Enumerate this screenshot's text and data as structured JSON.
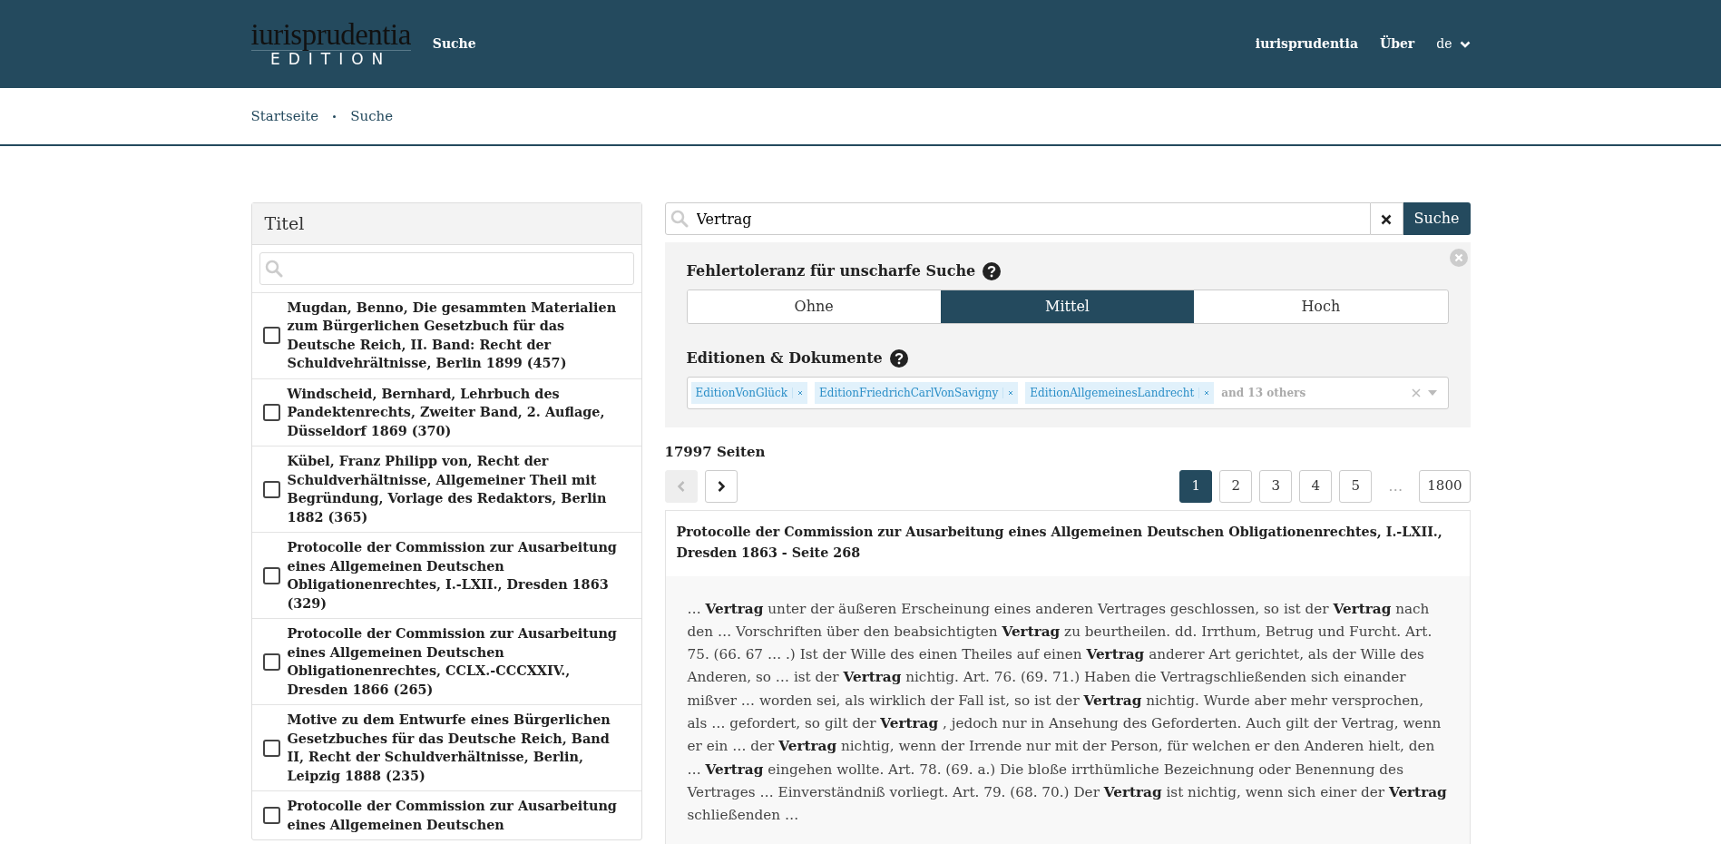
{
  "header": {
    "logo": {
      "title": "iurisprudentia",
      "subtitle": "EDITION"
    },
    "nav": [
      {
        "label": "Suche"
      }
    ],
    "right_nav": [
      {
        "label": "iurisprudentia"
      },
      {
        "label": "Über"
      }
    ],
    "language": {
      "label": "de"
    }
  },
  "breadcrumb": [
    {
      "label": "Startseite"
    },
    {
      "label": "Suche"
    }
  ],
  "title_filter": {
    "heading": "Titel",
    "items": [
      {
        "label": "Mugdan, Benno, Die gesammten Materialien zum Bürgerlichen Gesetzbuch für das Deutsche Reich, II. Band: Recht der Schuldvehrältnisse, Berlin 1899 (457)",
        "checked": false
      },
      {
        "label": "Windscheid, Bernhard, Lehrbuch des Pandektenrechts, Zweiter Band, 2. Auflage, Düsseldorf 1869 (370)",
        "checked": false
      },
      {
        "label": "Kübel, Franz Philipp von, Recht der Schuldverhältnisse, Allgemeiner Theil mit Begründung, Vorlage des Redaktors, Berlin 1882 (365)",
        "checked": false
      },
      {
        "label": "Protocolle der Commission zur Ausarbeitung eines Allgemeinen Deutschen Obligationenrechtes, I.-LXII., Dresden 1863 (329)",
        "checked": false
      },
      {
        "label": "Protocolle der Commission zur Ausarbeitung eines Allgemeinen Deutschen Obligationenrechtes, CCLX.-CCCXXIV., Dresden 1866 (265)",
        "checked": false
      },
      {
        "label": "Motive zu dem Entwurfe eines Bürgerlichen Gesetzbuches für das Deutsche Reich, Band II, Recht der Schuldverhältnisse, Berlin, Leipzig 1888 (235)",
        "checked": false
      },
      {
        "label": "Protocolle der Commission zur Ausarbeitung eines Allgemeinen Deutschen",
        "checked": false
      }
    ]
  },
  "search": {
    "value": "Vertrag",
    "button": "Suche"
  },
  "options": {
    "tolerance": {
      "label": "Fehlertoleranz für unscharfe Suche",
      "choices": [
        {
          "label": "Ohne",
          "selected": false
        },
        {
          "label": "Mittel",
          "selected": true
        },
        {
          "label": "Hoch",
          "selected": false
        }
      ]
    },
    "editions": {
      "label": "Editionen & Dokumente",
      "tags": [
        {
          "label": "EditionVonGlück"
        },
        {
          "label": "EditionFriedrichCarlVonSavigny"
        },
        {
          "label": "EditionAllgemeinesLandrecht"
        }
      ],
      "more": "and 13 others"
    }
  },
  "results": {
    "count": "17997 Seiten",
    "prev_disabled": true,
    "pages": [
      {
        "label": "1",
        "kind": "page",
        "selected": true
      },
      {
        "label": "2",
        "kind": "page",
        "selected": false
      },
      {
        "label": "3",
        "kind": "page",
        "selected": false
      },
      {
        "label": "4",
        "kind": "page",
        "selected": false
      },
      {
        "label": "5",
        "kind": "page",
        "selected": false
      },
      {
        "label": "…",
        "kind": "gap"
      },
      {
        "label": "1800",
        "kind": "page",
        "selected": false
      }
    ],
    "items": [
      {
        "title": "Protocolle der Commission zur Ausarbeitung eines Allgemeinen Deutschen Obligationenrechtes, I.-LXII., Dresden 1863 - Seite 268",
        "snippet": "… **Vertrag** unter der äußeren Erscheinung eines anderen Vertrages geschlossen, so ist der **Vertrag** nach den … Vorschriften über den beabsichtigten **Vertrag** zu beurtheilen. dd. Irrthum, Betrug und Furcht. Art. 75. (66. 67 … .) Ist der Wille des einen Theiles auf einen **Vertrag** anderer Art gerichtet, als der Wille des Anderen, so … ist der **Vertrag** nichtig. Art. 76. (69. 71.) Haben die Vertragschließenden sich einander mißver … worden sei, als wirklich der Fall ist, so ist der **Vertrag** nichtig. Wurde aber mehr versprochen, als … gefordert, so gilt der **Vertrag** , jedoch nur in Ansehung des Geforderten. Auch gilt der Vertrag, wenn er ein … der **Vertrag** nichtig, wenn der Irrende nur mit der Person, für welchen er den Anderen hielt, den … **Vertrag** eingehen wollte. Art. 78. (69. a.) Die bloße irrthümliche Bezeichnung oder Benennung des Vertrages … Einverständniß vorliegt. Art. 79. (68. 70.) Der **Vertrag** ist nichtig, wenn sich einer der **Vertrag** schließenden …"
      }
    ]
  }
}
